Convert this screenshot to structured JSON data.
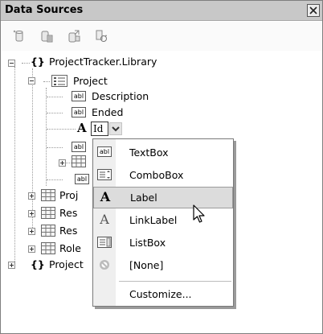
{
  "window": {
    "title": "Data Sources"
  },
  "toolbar": {
    "buttons": [
      {
        "icon": "add-data-source-icon"
      },
      {
        "icon": "edit-dataset-icon"
      },
      {
        "icon": "configure-icon"
      },
      {
        "icon": "refresh-icon"
      }
    ]
  },
  "tree": {
    "root": {
      "brace": "{}",
      "label": "ProjectTracker.Library"
    },
    "project": {
      "label": "Project"
    },
    "fields": [
      {
        "badge": "abl",
        "label": "Description"
      },
      {
        "badge": "abl",
        "label": "Ended"
      }
    ],
    "id_field": {
      "badge": "A",
      "control_value": "Id"
    },
    "hidden_rows": [
      {
        "badge": "abl"
      },
      {
        "badge": "table"
      },
      {
        "badge": "abl"
      }
    ],
    "collapsed_items": [
      {
        "label": "Proj"
      },
      {
        "label": "Res"
      },
      {
        "label": "Res"
      },
      {
        "label": "Role"
      }
    ],
    "second_root": {
      "brace": "{}",
      "label": "Project"
    }
  },
  "menu": {
    "items": [
      {
        "icon": "abl",
        "label": "TextBox",
        "selected": false
      },
      {
        "icon": "combo",
        "label": "ComboBox",
        "selected": false
      },
      {
        "icon": "A",
        "label": "Label",
        "selected": true
      },
      {
        "icon": "A",
        "label": "LinkLabel",
        "selected": false
      },
      {
        "icon": "list",
        "label": "ListBox",
        "selected": false
      },
      {
        "icon": "none",
        "label": "[None]",
        "selected": false
      }
    ],
    "footer": {
      "label": "Customize..."
    }
  },
  "colors": {
    "titlebar": "#c8c8c8",
    "menu_gutter": "#efefef",
    "menu_selected": "#dcdcdc"
  }
}
